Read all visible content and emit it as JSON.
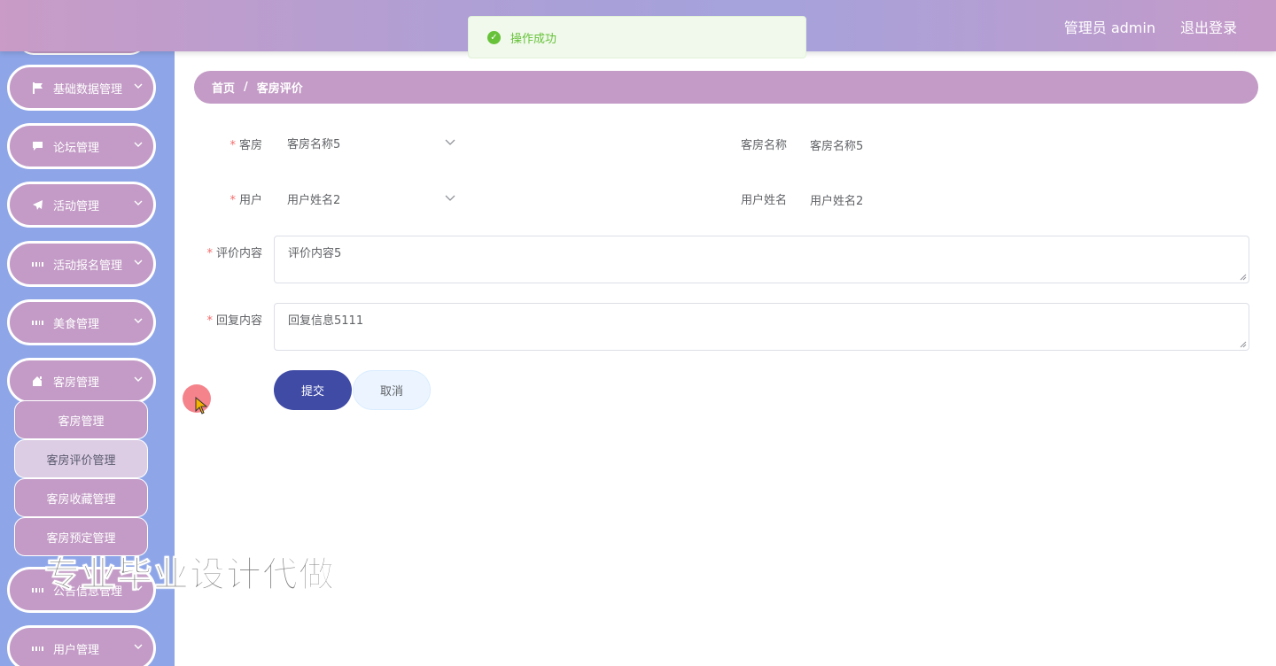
{
  "header": {
    "user_label": "管理员 admin",
    "logout_label": "退出登录"
  },
  "toast": {
    "message": "操作成功",
    "color": "#67c23a"
  },
  "sidebar": {
    "items": [
      {
        "label": "基础数据管理",
        "icon": "flag-icon"
      },
      {
        "label": "论坛管理",
        "icon": "chat-icon"
      },
      {
        "label": "活动管理",
        "icon": "send-icon"
      },
      {
        "label": "活动报名管理",
        "icon": "grid-icon"
      },
      {
        "label": "美食管理",
        "icon": "grid-icon"
      },
      {
        "label": "客房管理",
        "icon": "home-icon"
      },
      {
        "label": "公告信息管理",
        "icon": "grid-icon"
      },
      {
        "label": "用户管理",
        "icon": "grid-icon"
      }
    ],
    "submenu": [
      {
        "label": "客房管理"
      },
      {
        "label": "客房评价管理",
        "active": true
      },
      {
        "label": "客房收藏管理"
      },
      {
        "label": "客房预定管理"
      }
    ]
  },
  "breadcrumb": {
    "home": "首页",
    "separator": "/",
    "current": "客房评价"
  },
  "form": {
    "room_label": "客房",
    "room_value": "客房名称5",
    "room_name_label": "客房名称",
    "room_name_value": "客房名称5",
    "user_label": "用户",
    "user_value": "用户姓名2",
    "user_name_label": "用户姓名",
    "user_name_value": "用户姓名2",
    "comment_label": "评价内容",
    "comment_value": "评价内容5",
    "reply_label": "回复内容",
    "reply_value": "回复信息5111",
    "required_mark": "*"
  },
  "buttons": {
    "submit": "提交",
    "cancel": "取消"
  },
  "watermark": "专业毕业设计代做",
  "colors": {
    "accent": "#c39bc6",
    "sidebar_bg": "#8ea6e8",
    "primary_button": "#3f4ba5"
  }
}
